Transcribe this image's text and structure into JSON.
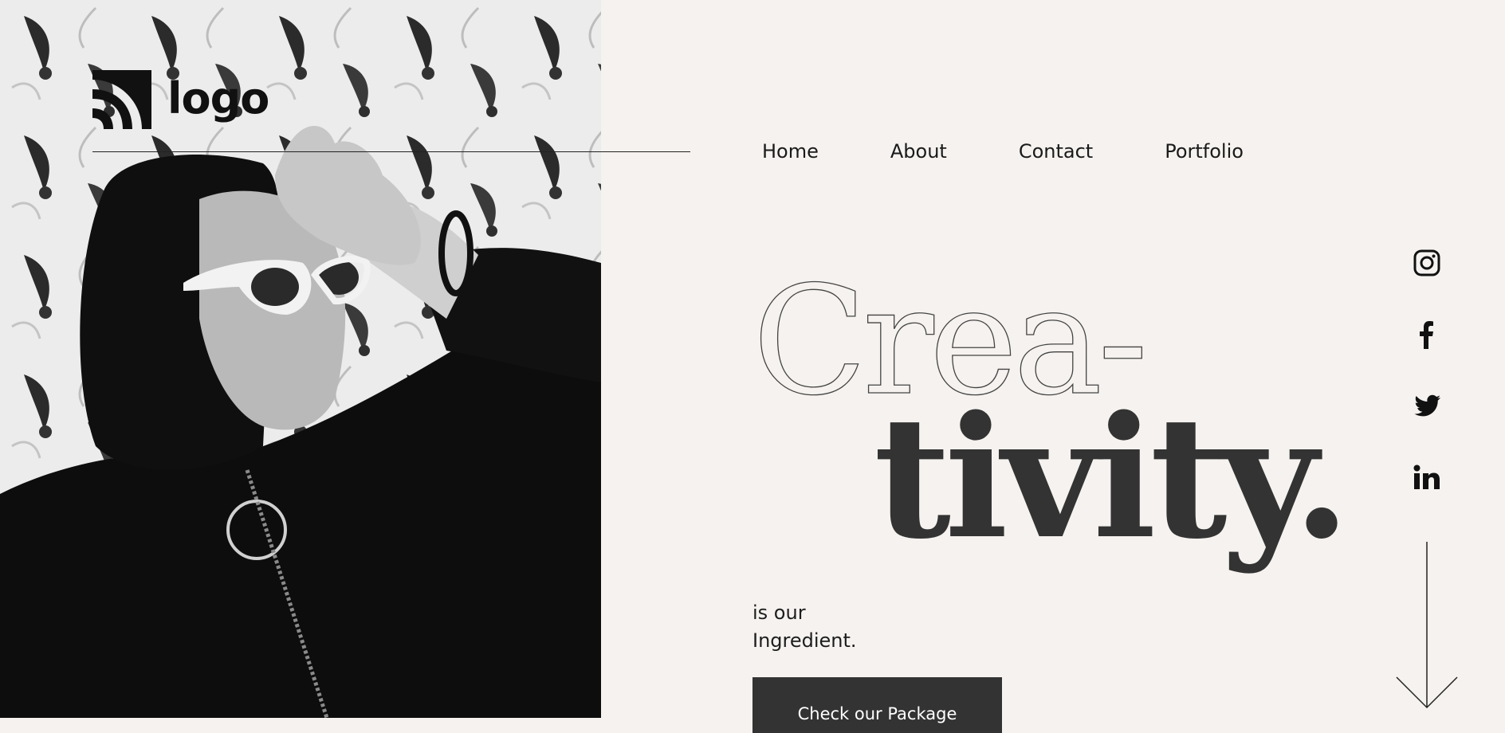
{
  "brand": {
    "logo_text": "logo"
  },
  "nav": {
    "items": [
      {
        "label": "Home"
      },
      {
        "label": "About"
      },
      {
        "label": "Contact"
      },
      {
        "label": "Portfolio"
      }
    ]
  },
  "hero": {
    "headline_line1": "Crea-",
    "headline_line2": "tivity.",
    "subtitle_line1": "is our",
    "subtitle_line2": "Ingredient.",
    "cta_label": "Check our Package"
  },
  "social": {
    "icons": [
      "instagram-icon",
      "facebook-icon",
      "twitter-icon",
      "linkedin-icon"
    ]
  },
  "colors": {
    "background": "#f5f2ef",
    "text": "#1c1c1c",
    "headline_solid": "#333333",
    "cta_bg": "#333333",
    "cta_text": "#ffffff"
  },
  "photo": {
    "description_icon": "woman-in-sunglasses-photo"
  }
}
